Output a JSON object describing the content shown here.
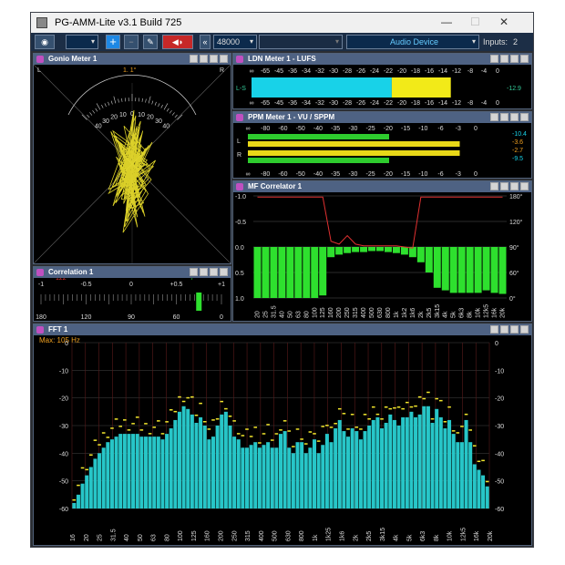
{
  "app": {
    "title": "PG-AMM-Lite v3.1 Build 725",
    "inputs_label": "Inputs:",
    "inputs_value": "2"
  },
  "toolbar": {
    "sample_rate": "48000",
    "audio_device": "Audio Device",
    "extra_dropdown": ""
  },
  "panels": {
    "gonio": {
      "title": "Gonio Meter 1",
      "top_value": "1. 1°",
      "l": "L",
      "r": "R",
      "scale": [
        "40",
        "30",
        "20",
        "10",
        "0",
        "10",
        "20",
        "30",
        "40"
      ]
    },
    "ldn": {
      "title": "LDN Meter 1 - LUFS",
      "scale": [
        "∞",
        "-65",
        "-45",
        "-36",
        "-34",
        "-32",
        "-30",
        "-28",
        "-26",
        "-24",
        "-22",
        "-20",
        "-18",
        "-16",
        "-14",
        "-12",
        "-8",
        "-4",
        "0"
      ],
      "channel": "L-S",
      "value": "-12.9"
    },
    "ppm": {
      "title": "PPM Meter 1 - VU / SPPM",
      "scale_top": [
        "∞",
        "-80",
        "-60",
        "-50",
        "-40",
        "-35",
        "-30",
        "-25",
        "-20",
        "-15",
        "-10",
        "-6",
        "-3",
        "0"
      ],
      "scale_bottom": [
        "∞",
        "-80",
        "-60",
        "-50",
        "-40",
        "-35",
        "-30",
        "-25",
        "-20",
        "-15",
        "-10",
        "-6",
        "-3",
        "0"
      ],
      "l": "L",
      "r": "R",
      "values": [
        "-10.4",
        "-3.6",
        "-2.7",
        "-9.5"
      ]
    },
    "mfc": {
      "title": "MF Correlator 1",
      "left_scale": [
        "-1.0",
        "-0.5",
        "0.0",
        "0.5",
        "1.0"
      ],
      "right_scale": [
        "180°",
        "120°",
        "90°",
        "60°",
        "0°"
      ],
      "bands": [
        "20",
        "25",
        "31.5",
        "40",
        "50",
        "63",
        "80",
        "100",
        "125",
        "160",
        "200",
        "250",
        "315",
        "400",
        "500",
        "630",
        "800",
        "1k",
        "1k2",
        "1k6",
        "2k",
        "2k5",
        "3k15",
        "4k",
        "5k",
        "6k3",
        "8k",
        "10k",
        "12k5",
        "16k",
        "20k"
      ],
      "correlation": [
        1.0,
        1.0,
        1.0,
        1.0,
        1.0,
        1.0,
        1.0,
        1.0,
        0.95,
        0.2,
        0.15,
        0.12,
        0.1,
        0.1,
        0.08,
        0.08,
        0.1,
        0.12,
        0.15,
        0.2,
        0.3,
        0.5,
        0.8,
        0.85,
        0.9,
        0.9,
        0.9,
        0.9,
        0.85,
        0.9,
        0.92
      ],
      "phase": [
        178,
        178,
        178,
        178,
        178,
        178,
        178,
        178,
        178,
        100,
        95,
        110,
        95,
        92,
        92,
        92,
        92,
        92,
        90,
        88,
        178,
        178,
        178,
        178,
        178,
        178,
        178,
        178,
        178,
        178,
        178
      ]
    },
    "correlation": {
      "title": "Correlation 1",
      "top_scale": [
        "-1",
        "-0.5",
        "0",
        "+0.5",
        "+1"
      ],
      "bottom_scale": [
        "180",
        "120",
        "90",
        "60",
        "0"
      ],
      "red_value": "122",
      "green_value": "7",
      "reading": 0.75
    },
    "fft": {
      "title": "FFT 1",
      "max_label": "Max: 105 Hz",
      "left_scale": [
        "0",
        "-10",
        "-20",
        "-30",
        "-40",
        "-50",
        "-60"
      ],
      "right_scale": [
        "0",
        "-10",
        "-20",
        "-30",
        "-40",
        "-50",
        "-60"
      ],
      "bands": [
        "16",
        "20",
        "25",
        "31.5",
        "40",
        "50",
        "63",
        "80",
        "100",
        "125",
        "160",
        "200",
        "250",
        "315",
        "400",
        "500",
        "630",
        "800",
        "1k",
        "1k25",
        "1k6",
        "2k",
        "2k5",
        "3k15",
        "4k",
        "5k",
        "6k3",
        "8k",
        "10k",
        "12k5",
        "16k",
        "20k"
      ],
      "levels": [
        -58,
        -55,
        -51,
        -48,
        -45,
        -42,
        -40,
        -38,
        -36,
        -35,
        -34,
        -33,
        -33,
        -33,
        -33,
        -33,
        -34,
        -34,
        -34,
        -34,
        -34,
        -35,
        -33,
        -31,
        -28,
        -25,
        -23,
        -24,
        -26,
        -29,
        -27,
        -30,
        -35,
        -34,
        -30,
        -26,
        -25,
        -30,
        -34,
        -35,
        -38,
        -38,
        -37,
        -36,
        -38,
        -37,
        -36,
        -38,
        -38,
        -33,
        -32,
        -38,
        -40,
        -36,
        -36,
        -40,
        -38,
        -35,
        -40,
        -37,
        -33,
        -36,
        -31,
        -28,
        -32,
        -34,
        -31,
        -32,
        -35,
        -32,
        -30,
        -28,
        -27,
        -31,
        -29,
        -26,
        -28,
        -30,
        -27,
        -27,
        -25,
        -27,
        -26,
        -23,
        -23,
        -29,
        -24,
        -27,
        -31,
        -28,
        -33,
        -36,
        -36,
        -28,
        -36,
        -44,
        -46,
        -48,
        -52
      ]
    }
  }
}
